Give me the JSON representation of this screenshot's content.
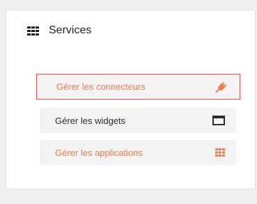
{
  "panel": {
    "title": "Services",
    "title_icon": "grid-icon"
  },
  "services": [
    {
      "label": "Gérer les connecteurs",
      "icon": "plug-icon",
      "text_color": "#f07a4b",
      "border_color": "#ef4d4d"
    },
    {
      "label": "Gérer les widgets",
      "icon": "window-icon",
      "text_color": "#2b2b2b"
    },
    {
      "label": "Gérer les applications",
      "icon": "apps-icon",
      "text_color": "#f07a4b"
    }
  ]
}
